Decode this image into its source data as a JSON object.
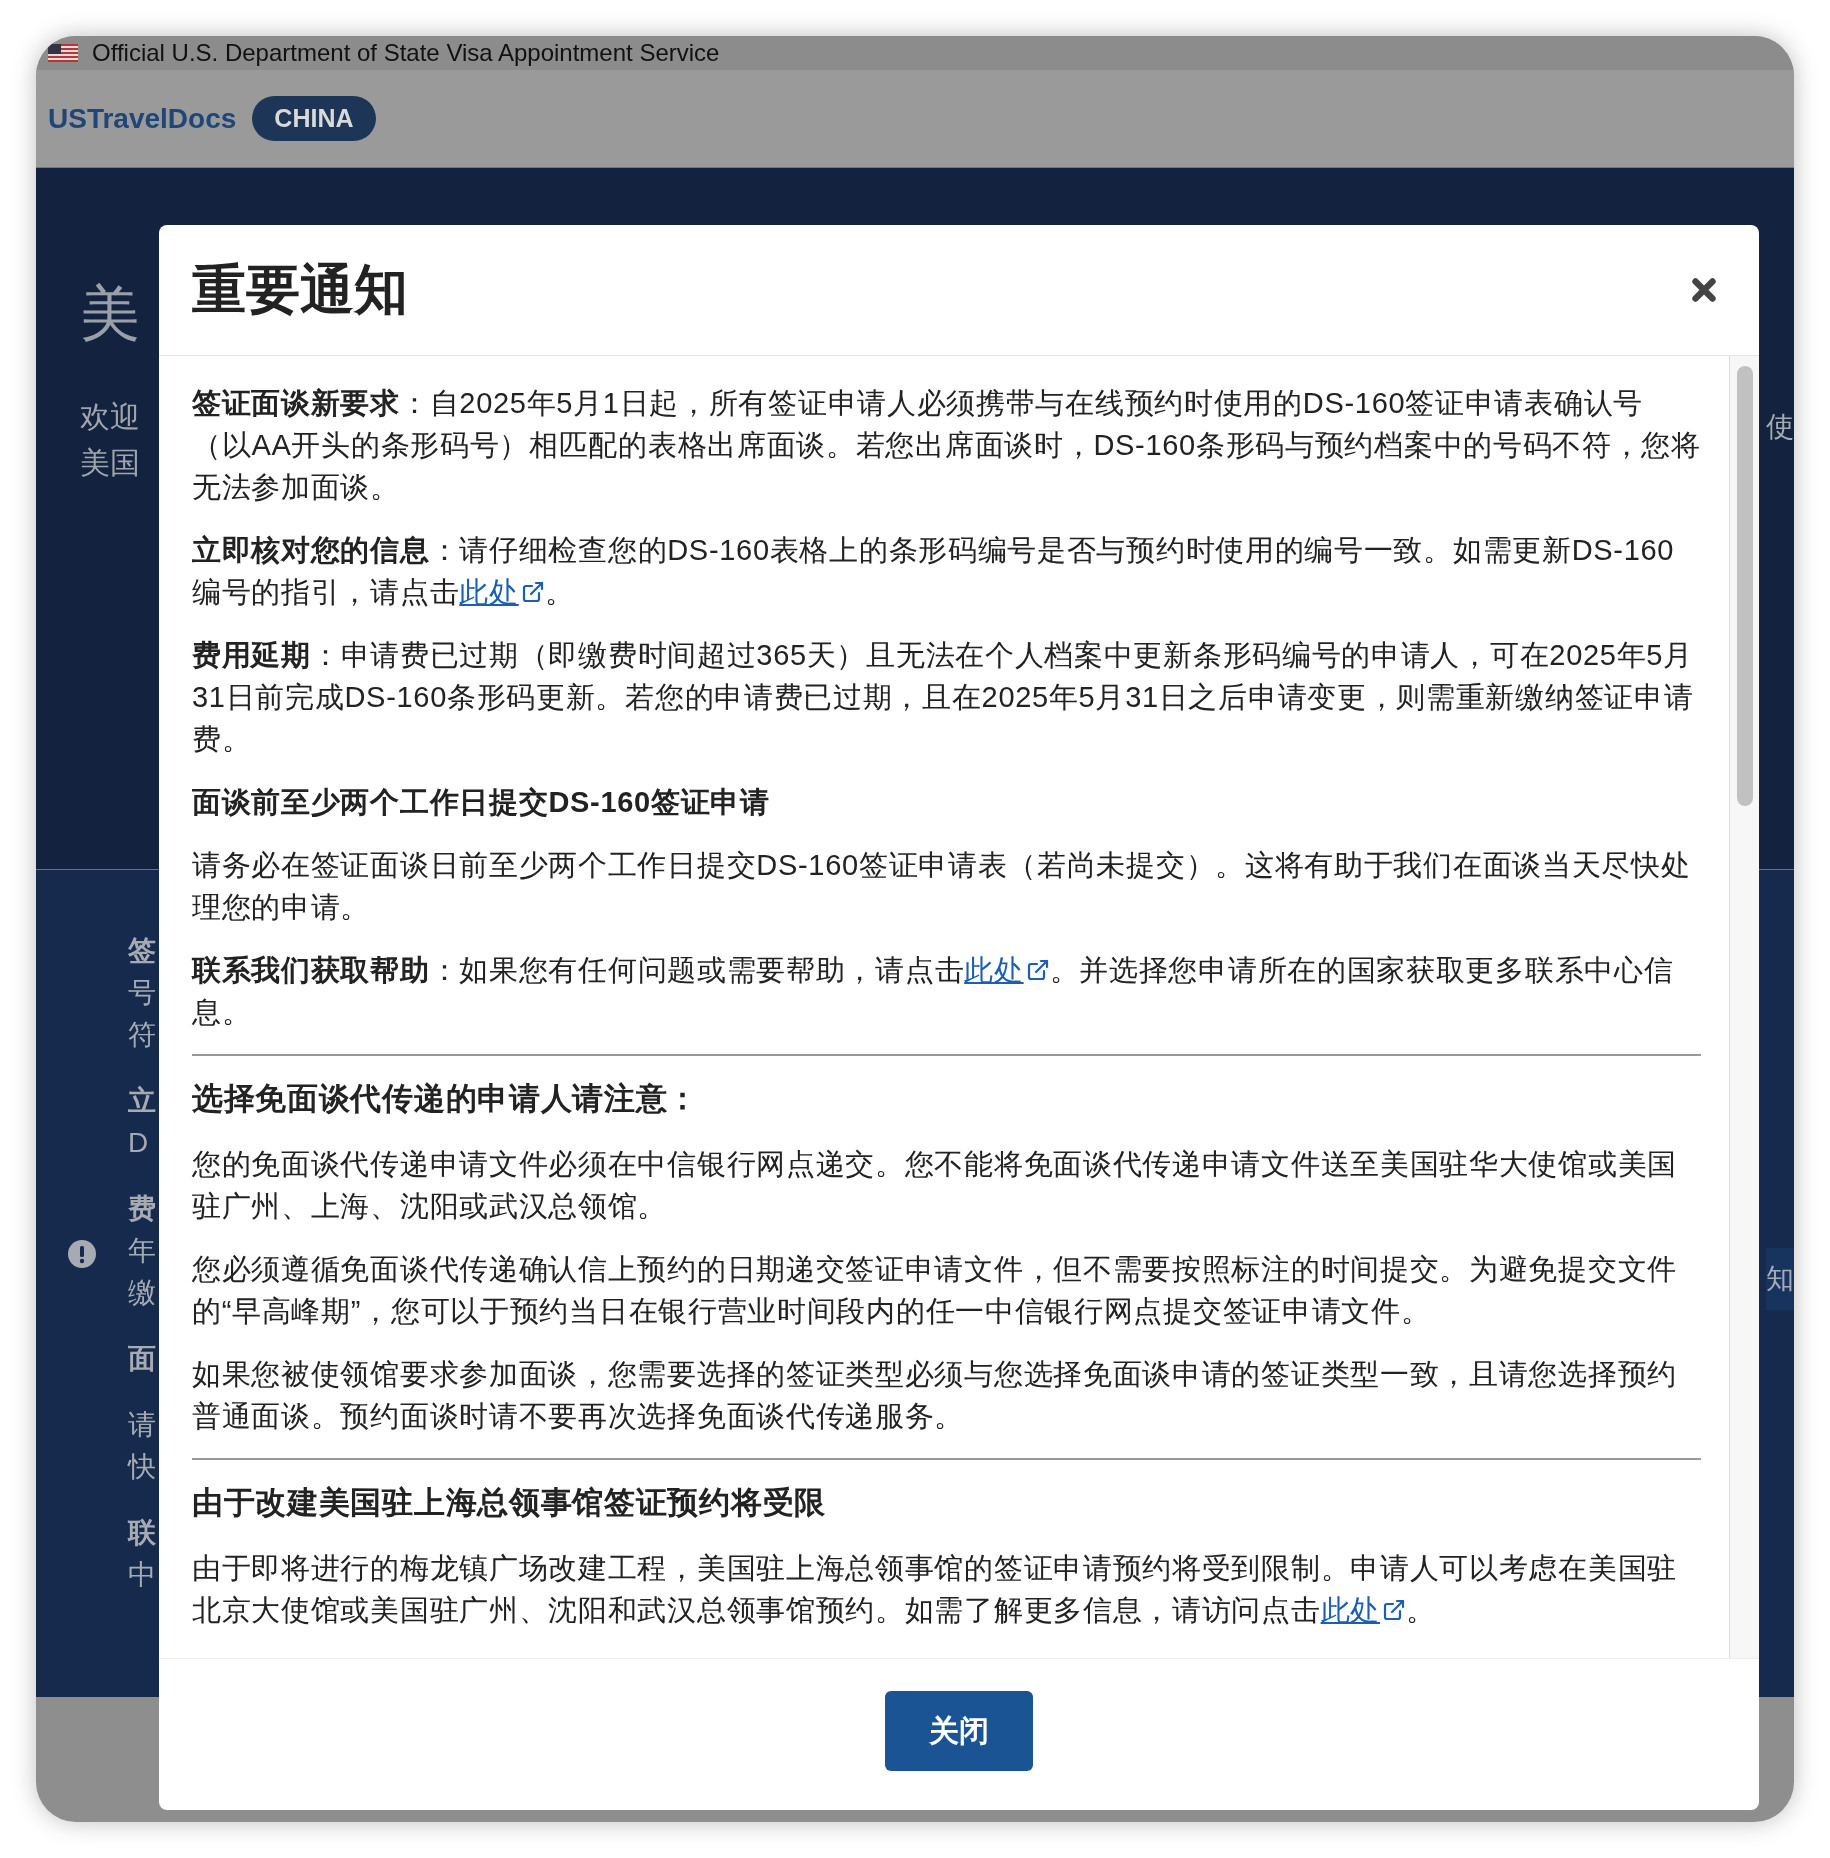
{
  "banner": {
    "text": "Official U.S. Department of State Visa Appointment Service"
  },
  "header": {
    "logo": "USTravelDocs",
    "badge": "CHINA"
  },
  "background_page": {
    "hero_title": "美",
    "hero_lines": [
      "欢迎",
      "美国"
    ],
    "notice_paragraphs": [
      {
        "bold_first": true,
        "lines": [
          "签",
          "号",
          "符"
        ]
      },
      {
        "bold_first": true,
        "lines": [
          "立",
          "D"
        ]
      },
      {
        "bold_first": true,
        "lines": [
          "费",
          "年",
          "缴"
        ]
      },
      {
        "bold_first": true,
        "lines": [
          "面"
        ]
      },
      {
        "bold_first": false,
        "lines": [
          "请",
          "快"
        ]
      },
      {
        "bold_first": true,
        "lines": [
          "联",
          "中"
        ]
      }
    ],
    "right_fragments": [
      "使",
      "知"
    ]
  },
  "modal": {
    "title": "重要通知",
    "sections": [
      {
        "kind": "paragraph",
        "text": "**签证面谈新要求**：自2025年5月1日起，所有签证申请人必须携带与在线预约时使用的DS-160签证申请表确认号（以AA开头的条形码号）相匹配的表格出席面谈。若您出席面谈时，DS-160条形码与预约档案中的号码不符，您将无法参加面谈。"
      },
      {
        "kind": "paragraph",
        "text": "**立即核对您的信息**：请仔细检查您的DS-160表格上的条形码编号是否与预约时使用的编号一致。如需更新DS-160编号的指引，请点击",
        "link": "此处",
        "after": "。"
      },
      {
        "kind": "paragraph",
        "text": "**费用延期**：申请费已过期（即缴费时间超过365天）且无法在个人档案中更新条形码编号的申请人，可在2025年5月31日前完成DS-160条形码更新。若您的申请费已过期，且在2025年5月31日之后申请变更，则需重新缴纳签证申请费。"
      },
      {
        "kind": "label",
        "text": "面谈前至少两个工作日提交DS-160签证申请"
      },
      {
        "kind": "paragraph",
        "text": "请务必在签证面谈日前至少两个工作日提交DS-160签证申请表（若尚未提交）。这将有助于我们在面谈当天尽快处理您的申请。"
      },
      {
        "kind": "paragraph",
        "text": "**联系我们获取帮助**：如果您有任何问题或需要帮助，请点击",
        "link": "此处",
        "after": "。并选择您申请所在的国家获取更多联系中心信息。"
      },
      {
        "kind": "divider"
      },
      {
        "kind": "heading",
        "text": "选择免面谈代传递的申请人请注意："
      },
      {
        "kind": "paragraph",
        "text": "您的免面谈代传递申请文件必须在中信银行网点递交。您不能将免面谈代传递申请文件送至美国驻华大使馆或美国驻广州、上海、沈阳或武汉总领馆。"
      },
      {
        "kind": "paragraph",
        "text": "您必须遵循免面谈代传递确认信上预约的日期递交签证申请文件，但不需要按照标注的时间提交。为避免提交文件的“早高峰期”，您可以于预约当日在银行营业时间段内的任一中信银行网点提交签证申请文件。"
      },
      {
        "kind": "paragraph",
        "text": "如果您被使领馆要求参加面谈，您需要选择的签证类型必须与您选择免面谈申请的签证类型一致，且请您选择预约普通面谈。预约面谈时请不要再次选择免面谈代传递服务。"
      },
      {
        "kind": "divider"
      },
      {
        "kind": "heading",
        "text": "由于改建美国驻上海总领事馆签证预约将受限"
      },
      {
        "kind": "paragraph",
        "text": "由于即将进行的梅龙镇广场改建工程，美国驻上海总领事馆的签证申请预约将受到限制。申请人可以考虑在美国驻北京大使馆或美国驻广州、沈阳和武汉总领事馆预约。如需了解更多信息，请访问点击",
        "link": "此处",
        "after": "。"
      }
    ],
    "close_button": "关闭"
  }
}
